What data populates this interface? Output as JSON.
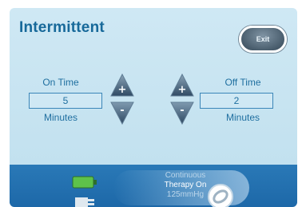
{
  "header": {
    "title": "Intermittent",
    "exit_label": "Exit"
  },
  "on_time": {
    "label": "On Time",
    "value": "5",
    "unit": "Minutes"
  },
  "off_time": {
    "label": "Off Time",
    "value": "2",
    "unit": "Minutes"
  },
  "status": {
    "line1": "Continuous",
    "line2": "Therapy On",
    "line3": "125mmHg"
  },
  "colors": {
    "panel": "#c2e1ef",
    "accent": "#1f6fa0",
    "status_bar": "#1d68a8",
    "battery": "#5ec24a"
  },
  "icons": [
    "plus-arrow-icon",
    "minus-arrow-icon",
    "battery-icon",
    "power-plug-icon",
    "therapy-toggle-icon"
  ]
}
